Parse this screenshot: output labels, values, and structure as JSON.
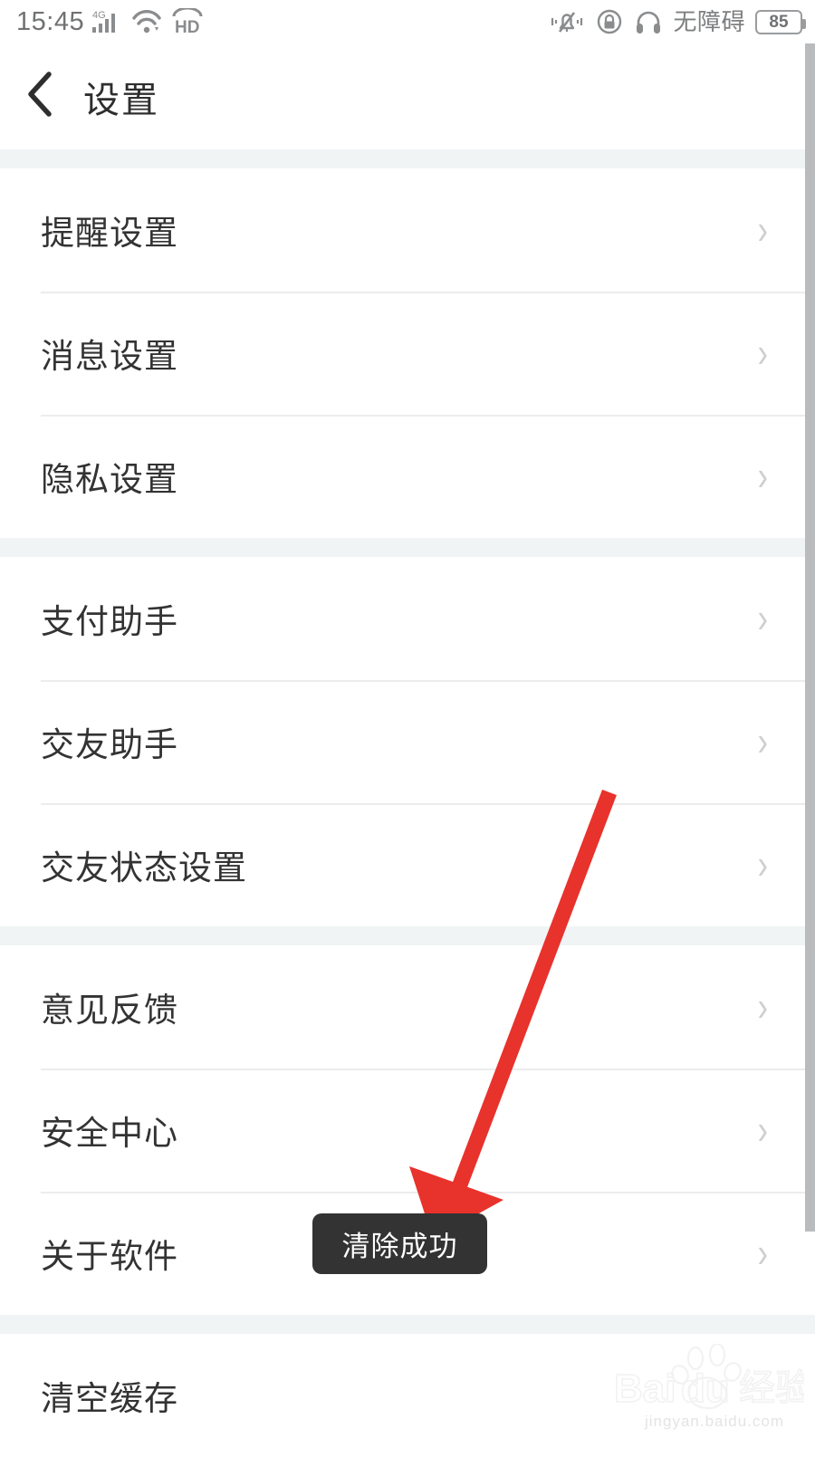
{
  "status_bar": {
    "time": "15:45",
    "network_type": "4G",
    "signal_icon": "signal-bars-icon",
    "wifi_icon": "wifi-icon",
    "hd_label": "HD",
    "vibrate_icon": "bell-vibrate-icon",
    "lock_icon": "lock-icon",
    "headset_icon": "headphones-icon",
    "accessibility_label": "无障碍",
    "battery_level": "85"
  },
  "header": {
    "back_icon": "chevron-left-icon",
    "title": "设置"
  },
  "list": {
    "chevron_icon": "chevron-right-icon",
    "groups": [
      {
        "rows": [
          {
            "label": "提醒设置"
          },
          {
            "label": "消息设置"
          },
          {
            "label": "隐私设置"
          }
        ]
      },
      {
        "rows": [
          {
            "label": "支付助手"
          },
          {
            "label": "交友助手"
          },
          {
            "label": "交友状态设置"
          }
        ]
      },
      {
        "rows": [
          {
            "label": "意见反馈"
          },
          {
            "label": "安全中心"
          },
          {
            "label": "关于软件"
          }
        ]
      },
      {
        "rows": [
          {
            "label": "清空缓存"
          }
        ]
      }
    ]
  },
  "toast": {
    "message": "清除成功",
    "background": "#333334",
    "text_color": "#ffffff"
  },
  "annotation": {
    "arrow_color": "#e8322c",
    "arrow_name": "red-pointer-arrow"
  },
  "watermark": {
    "brand": "Baidu",
    "brand_cn": "经验",
    "url": "jingyan.baidu.com"
  }
}
